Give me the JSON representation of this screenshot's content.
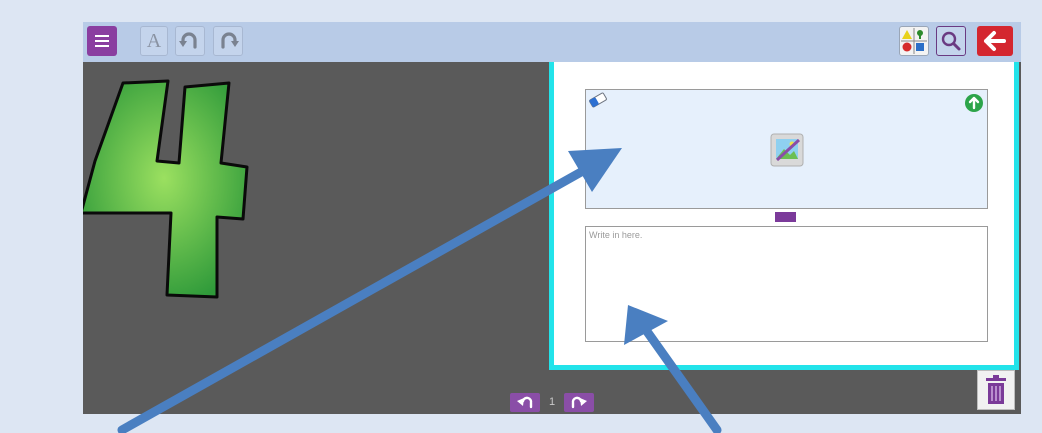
{
  "toolbar": {
    "text_button_label": "A"
  },
  "image_box": {
    "icons": [
      "eraser-icon",
      "upload-icon",
      "image-placeholder-icon"
    ]
  },
  "text_box": {
    "placeholder": "Write in here."
  },
  "pager": {
    "current_page": "1"
  },
  "decor": {
    "number_graphic": "4",
    "number_color": "#5fbf3f"
  },
  "colors": {
    "menu": "#8a3ea0",
    "toolbar": "#b8cbe7",
    "back": "#d4262f",
    "panel_border": "#22e3ea",
    "arrow": "#4a7fc1",
    "workspace": "#5a5a5a"
  }
}
